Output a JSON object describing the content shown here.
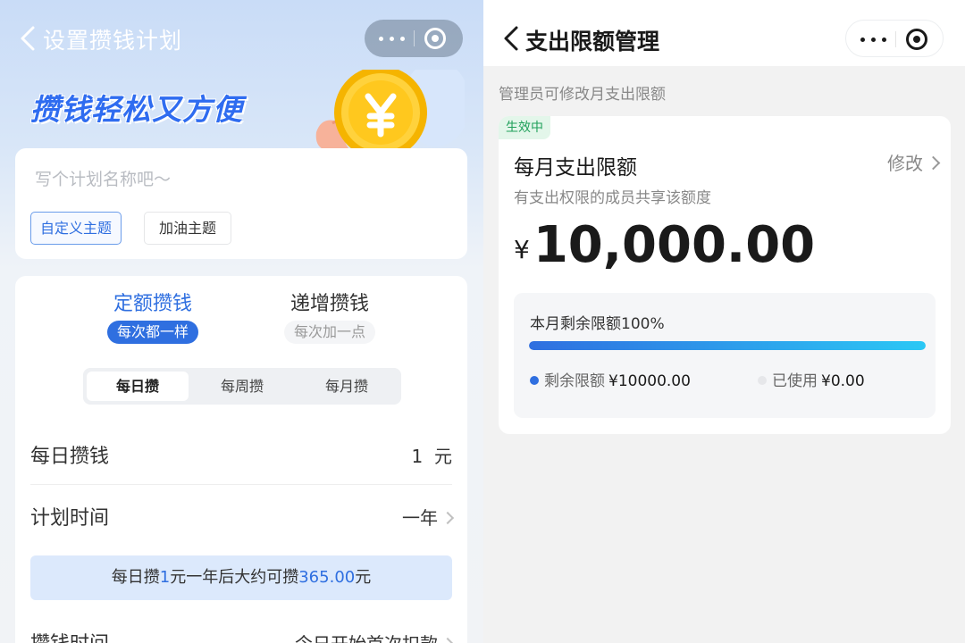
{
  "left": {
    "nav": {
      "title": "设置攒钱计划"
    },
    "banner": {
      "headline": "攒钱轻松又方便"
    },
    "name_card": {
      "placeholder": "写个计划名称吧～",
      "themes": [
        "自定义主题",
        "加油主题"
      ]
    },
    "modes": [
      {
        "title": "定额攒钱",
        "subtitle": "每次都一样",
        "selected": true
      },
      {
        "title": "递增攒钱",
        "subtitle": "每次加一点",
        "selected": false
      }
    ],
    "frequency_tabs": [
      {
        "label": "每日攒",
        "selected": true
      },
      {
        "label": "每周攒",
        "selected": false
      },
      {
        "label": "每月攒",
        "selected": false
      }
    ],
    "rows": [
      {
        "label": "每日攒钱",
        "value": "1  元"
      },
      {
        "label": "计划时间",
        "value": "一年"
      },
      {
        "label": "攒钱时间",
        "value": "今日开始首次扣款"
      }
    ],
    "hint": {
      "prefix": "每日攒",
      "amount": "1",
      "middle": "元一年后大约可攒",
      "total": "365.00",
      "suffix": "元"
    }
  },
  "right": {
    "nav": {
      "title": "支出限额管理"
    },
    "note": "管理员可修改月支出限额",
    "card": {
      "badge": "生效中",
      "title": "每月支出限额",
      "edit": "修改",
      "subtitle": "有支出权限的成员共享该额度",
      "currency": "¥",
      "amount": "10,000.00",
      "remaining_label": "本月剩余限额100%",
      "remaining_fraction": 1.0,
      "legend": [
        {
          "label": "剩余限额",
          "amount": "¥10000.00",
          "color": "#2f6fe0"
        },
        {
          "label": "已使用",
          "amount": "¥0.00",
          "color": "#e6e7ea"
        }
      ]
    }
  },
  "colors": {
    "accent": "#2f6fe0",
    "active_badge": "#1fa05a"
  }
}
